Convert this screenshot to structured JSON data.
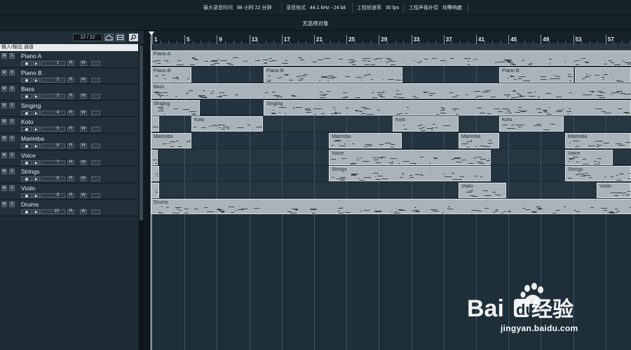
{
  "status_bar": {
    "max_record_time_label": "最大录音时间",
    "max_record_time_value": "98 小时 22 分钟",
    "record_format_label": "录音格式",
    "record_format_value": "44.1 kHz - 24 bit",
    "frame_rate_label": "工程帧速率",
    "frame_rate_value": "30 fps",
    "pan_law_label": "工程声像补偿",
    "pan_law_value": "均等响度"
  },
  "info_line": {
    "text": "无选择对象"
  },
  "track_panel": {
    "counter": "12 / 12",
    "io_label": "输入/输出 通道",
    "tracks": [
      {
        "name": "Piano A",
        "channel": "1"
      },
      {
        "name": "Piano B",
        "channel": "2"
      },
      {
        "name": "Bass",
        "channel": "3"
      },
      {
        "name": "Singing",
        "channel": "4"
      },
      {
        "name": "Koto",
        "channel": "5"
      },
      {
        "name": "Marimba",
        "channel": "6"
      },
      {
        "name": "Voice",
        "channel": "7"
      },
      {
        "name": "Strings",
        "channel": "8"
      },
      {
        "name": "Violin",
        "channel": "9"
      },
      {
        "name": "Drums",
        "channel": "10"
      }
    ]
  },
  "ruler": {
    "bars": [
      "1",
      "5",
      "9",
      "13",
      "17",
      "21",
      "25",
      "29",
      "33",
      "37",
      "41",
      "45",
      "49",
      "53",
      "57"
    ]
  },
  "parts": [
    {
      "track": 0,
      "label": "Piano A"
    },
    {
      "track": 1,
      "label": "Piano B"
    },
    {
      "track": 1,
      "label": "Piano B"
    },
    {
      "track": 1,
      "label": "Piano B"
    },
    {
      "track": 1,
      "label": ""
    },
    {
      "track": 2,
      "label": "Bass"
    },
    {
      "track": 3,
      "label": "Singing"
    },
    {
      "track": 3,
      "label": "Singing"
    },
    {
      "track": 4,
      "label": ""
    },
    {
      "track": 4,
      "label": "Koto"
    },
    {
      "track": 4,
      "label": "Koto"
    },
    {
      "track": 4,
      "label": "Koto"
    },
    {
      "track": 5,
      "label": "Marimba"
    },
    {
      "track": 5,
      "label": "Marimba"
    },
    {
      "track": 5,
      "label": "Marimba"
    },
    {
      "track": 5,
      "label": "Marimba"
    },
    {
      "track": 6,
      "label": ""
    },
    {
      "track": 6,
      "label": "Voice"
    },
    {
      "track": 6,
      "label": "Voice"
    },
    {
      "track": 7,
      "label": ""
    },
    {
      "track": 7,
      "label": "Strings"
    },
    {
      "track": 7,
      "label": "Strings"
    },
    {
      "track": 8,
      "label": ""
    },
    {
      "track": 8,
      "label": "Violin"
    },
    {
      "track": 8,
      "label": "Violin"
    },
    {
      "track": 9,
      "label": "Drums"
    }
  ],
  "watermark": {
    "logo_text": "Bai du 经验",
    "url": "jingyan.baidu.com"
  },
  "colors": {
    "background": "#1b2a33",
    "part_fill": "#a9b3b9",
    "grid_line": "#3e5260"
  }
}
